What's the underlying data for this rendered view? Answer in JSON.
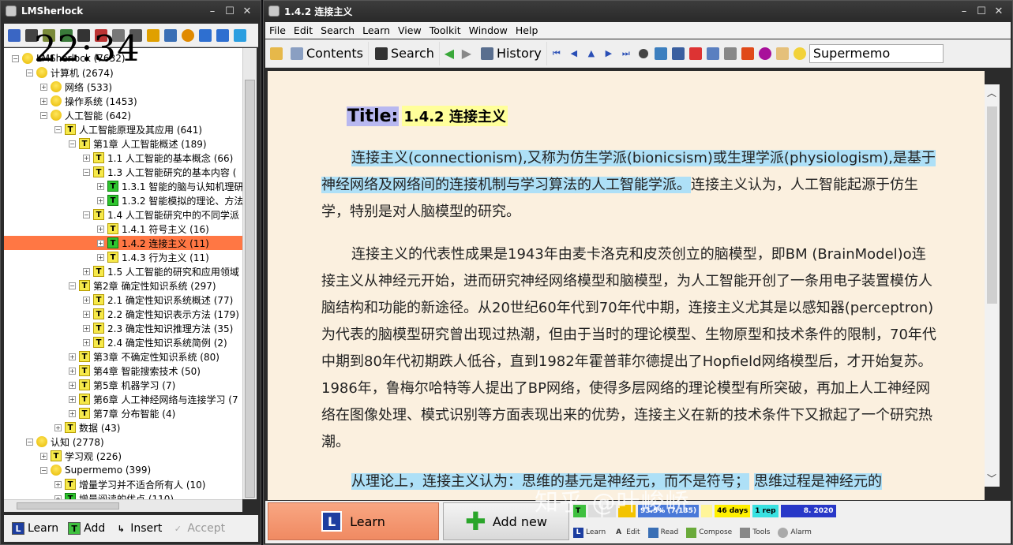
{
  "left_window": {
    "title": "LMSherlock",
    "clock": "22:34",
    "tree": [
      {
        "label": "LMSherlock (7632)",
        "icon": "bulb",
        "exp": "−"
      },
      {
        "label": "计算机 (2674)",
        "icon": "bulb",
        "exp": "−"
      },
      {
        "label": "网络 (533)",
        "icon": "bulb",
        "exp": "+"
      },
      {
        "label": "操作系统 (1453)",
        "icon": "bulb",
        "exp": "+"
      },
      {
        "label": "人工智能 (642)",
        "icon": "bulb",
        "exp": "−"
      },
      {
        "label": "人工智能原理及其应用 (641)",
        "icon": "t",
        "exp": "−"
      },
      {
        "label": "第1章 人工智能概述 (189)",
        "icon": "t",
        "exp": "−"
      },
      {
        "label": "1.1 人工智能的基本概念 (66)",
        "icon": "t",
        "exp": "+"
      },
      {
        "label": "1.3 人工智能研究的基本内容 (",
        "icon": "t",
        "exp": "−"
      },
      {
        "label": "1.3.1 智能的脑与认知机理研",
        "icon": "tg",
        "exp": "+"
      },
      {
        "label": "1.3.2 智能模拟的理论、方法",
        "icon": "tg",
        "exp": "+"
      },
      {
        "label": "1.4 人工智能研究中的不同学派",
        "icon": "t",
        "exp": "−"
      },
      {
        "label": "1.4.1 符号主义 (16)",
        "icon": "t",
        "exp": "+"
      },
      {
        "label": "1.4.2 连接主义 (11)",
        "icon": "tg",
        "exp": "+"
      },
      {
        "label": "1.4.3 行为主义 (11)",
        "icon": "t",
        "exp": "+"
      },
      {
        "label": "1.5 人工智能的研究和应用领域",
        "icon": "t",
        "exp": "+"
      },
      {
        "label": "第2章 确定性知识系统 (297)",
        "icon": "t",
        "exp": "−"
      },
      {
        "label": "2.1 确定性知识系统概述 (77)",
        "icon": "t",
        "exp": "+"
      },
      {
        "label": "2.2 确定性知识表示方法 (179)",
        "icon": "t",
        "exp": "+"
      },
      {
        "label": "2.3 确定性知识推理方法 (35)",
        "icon": "t",
        "exp": "+"
      },
      {
        "label": "2.4 确定性知识系统简例 (2)",
        "icon": "t",
        "exp": "+"
      },
      {
        "label": "第3章 不确定性知识系统 (80)",
        "icon": "t",
        "exp": "+"
      },
      {
        "label": "第4章 智能搜索技术 (50)",
        "icon": "t",
        "exp": "+"
      },
      {
        "label": "第5章 机器学习 (7)",
        "icon": "t",
        "exp": "+"
      },
      {
        "label": "第6章 人工神经网络与连接学习 (7",
        "icon": "t",
        "exp": "+"
      },
      {
        "label": "第7章 分布智能 (4)",
        "icon": "t",
        "exp": "+"
      },
      {
        "label": "数据 (43)",
        "icon": "t",
        "exp": "+"
      },
      {
        "label": "认知 (2778)",
        "icon": "bulb",
        "exp": "−"
      },
      {
        "label": "学习观 (226)",
        "icon": "t",
        "exp": "+"
      },
      {
        "label": "Supermemo (399)",
        "icon": "bulb",
        "exp": "−"
      },
      {
        "label": "增量学习并不适合所有人 (10)",
        "icon": "t",
        "exp": "+"
      },
      {
        "label": "增量阅读的优点 (110)",
        "icon": "tg",
        "exp": "+"
      }
    ],
    "bottom_buttons": [
      {
        "label": "Learn",
        "icon": "L"
      },
      {
        "label": "Add",
        "icon": "T"
      },
      {
        "label": "Insert",
        "icon": "↳"
      },
      {
        "label": "Accept",
        "icon": "✓"
      }
    ]
  },
  "right_window": {
    "title": "1.4.2 连接主义",
    "menu": [
      "File",
      "Edit",
      "Search",
      "Learn",
      "View",
      "Toolkit",
      "Window",
      "Help"
    ],
    "toolbar": {
      "contents": "Contents",
      "search": "Search",
      "history": "History",
      "search_box_value": "Supermemo"
    },
    "content": {
      "title_label": "Title:",
      "title_text": "1.4.2 连接主义",
      "p1_hl": "连接主义(connectionism),又称为仿生学派(bionicsism)或生理学派(physiologism),是基于神经网络及网络间的连接机制与学习算法的人工智能学派。",
      "p1_rest": "连接主义认为，人工智能起源于仿生学，特别是对人脑模型的研究。",
      "p2": "连接主义的代表性成果是1943年由麦卡洛克和皮茨创立的脑模型，即BM (BrainModel)o连接主义从神经元开始，进而研究神经网络模型和脑模型，为人工智能开创了一条用电子装置模仿人脑结构和功能的新途径。从20世纪60年代到70年代中期，连接主义尤其是以感知器(perceptron)为代表的脑模型研究曾出现过热潮，但由于当时的理论模型、生物原型和技术条件的限制，70年代中期到80年代初期跌人低谷，直到1982年霍普菲尔德提出了Hopfield网络模型后，才开始复苏。1986年，鲁梅尔哈特等人提出了BP网络，使得多层网络的理论模型有所突破，再加上人工神经网络在图像处理、模式识别等方面表现出来的优势，连接主义在新的技术条件下又掀起了一个研究热潮。",
      "p3_hl1": "从理论上，连接主义认为：思维的基元是神经元，而不是符号；",
      "p3_hl2": "思维过程是神经元的"
    },
    "bottom": {
      "learn": "Learn",
      "add_new": "Add new",
      "status": [
        "93.5% (7,135)",
        "46 days",
        "1 rep",
        "8. 2020"
      ],
      "tabs": [
        "Learn",
        "Edit",
        "Read",
        "Compose",
        "Tools",
        "Alarm"
      ]
    },
    "watermark": "知乎 @叶峻峤"
  },
  "colors": {
    "selection": "#ff7744",
    "highlight": "#aee0f7",
    "page_bg": "#fbf0df",
    "title_label_bg": "#b8b8f0",
    "title_text_bg": "#ffff9a"
  }
}
